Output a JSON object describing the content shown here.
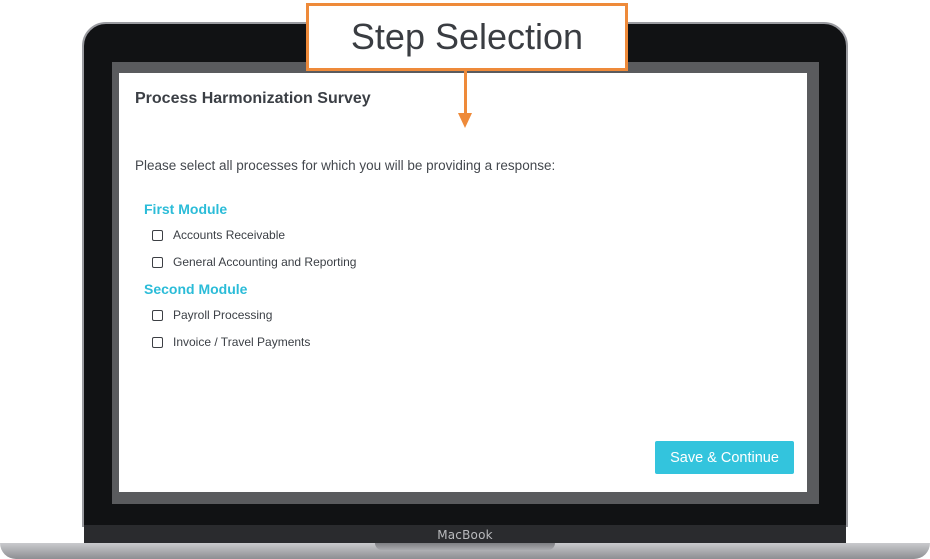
{
  "annotation": {
    "label": "Step Selection",
    "color": "#ee8a3a"
  },
  "device": {
    "brand": "MacBook"
  },
  "survey": {
    "title": "Process Harmonization Survey",
    "instructions": "Please select all processes for which you will be providing a response:",
    "accent_color": "#2bbcd8",
    "modules": [
      {
        "heading": "First Module",
        "options": [
          {
            "label": "Accounts Receivable",
            "checked": false
          },
          {
            "label": "General Accounting and Reporting",
            "checked": false
          }
        ]
      },
      {
        "heading": "Second Module",
        "options": [
          {
            "label": "Payroll Processing",
            "checked": false
          },
          {
            "label": "Invoice / Travel Payments",
            "checked": false
          }
        ]
      }
    ],
    "save_label": "Save & Continue",
    "button_color": "#33c4dd"
  }
}
